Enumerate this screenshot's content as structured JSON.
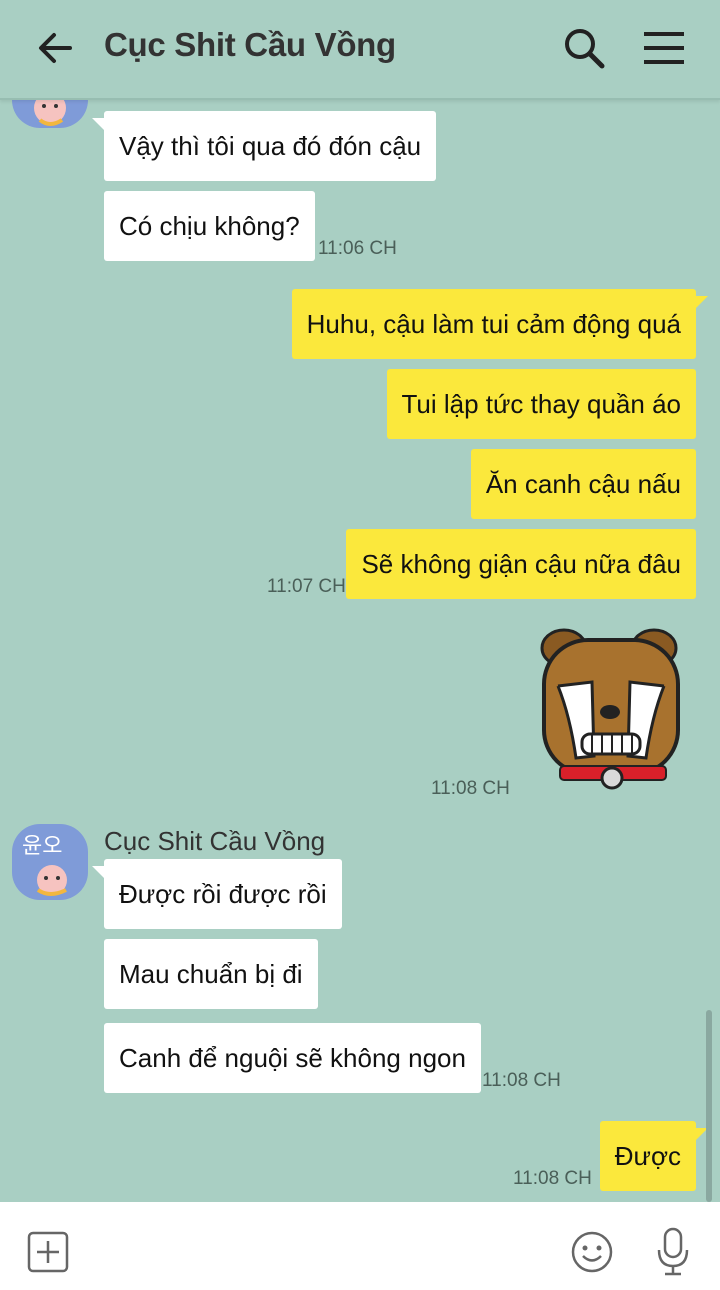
{
  "header": {
    "title": "Cục Shit Cầu Vồng",
    "back_icon": "arrow-left-icon",
    "search_icon": "search-icon",
    "menu_icon": "hamburger-menu-icon"
  },
  "colors": {
    "background": "#a9cfc3",
    "incoming_bubble": "#ffffff",
    "outgoing_bubble": "#fbe83c"
  },
  "messages": {
    "m1": {
      "text": "Vậy thì tôi qua đó đón cậu",
      "direction": "incoming"
    },
    "m2": {
      "text": "Có chịu không?",
      "direction": "incoming",
      "time": "11:06 CH"
    },
    "m3": {
      "text": "Huhu, cậu làm tui cảm động quá",
      "direction": "outgoing"
    },
    "m4": {
      "text": "Tui lập tức thay quần áo",
      "direction": "outgoing"
    },
    "m5": {
      "text": "Ăn canh cậu nấu",
      "direction": "outgoing"
    },
    "m6": {
      "text": "Sẽ không giận cậu nữa đâu",
      "direction": "outgoing",
      "time": "11:07 CH"
    },
    "sticker": {
      "name": "crying-bear-sticker",
      "direction": "outgoing",
      "time": "11:08 CH"
    },
    "group2": {
      "sender": "Cục Shit Cầu Vồng",
      "avatar_text": "윤오"
    },
    "m7": {
      "text": "Được rồi được rồi",
      "direction": "incoming"
    },
    "m8": {
      "text": "Mau chuẩn bị đi",
      "direction": "incoming"
    },
    "m9": {
      "text": "Canh để nguội sẽ không ngon",
      "direction": "incoming",
      "time": "11:08 CH"
    },
    "m10": {
      "text": "Được",
      "direction": "outgoing",
      "time": "11:08 CH"
    }
  },
  "input_bar": {
    "plus_icon": "plus-box-icon",
    "emoji_icon": "smiley-icon",
    "mic_icon": "microphone-icon"
  }
}
